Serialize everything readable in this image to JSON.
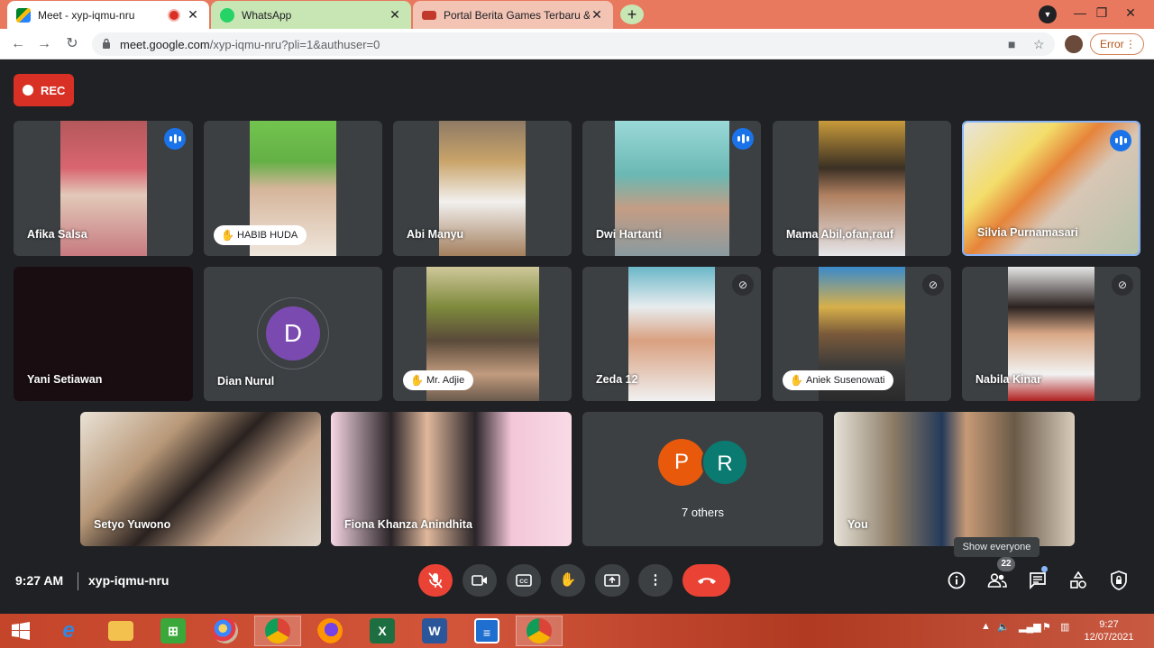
{
  "browser": {
    "tabs": [
      {
        "title": "Meet - xyp-iqmu-nru",
        "close": "✕"
      },
      {
        "title": "WhatsApp",
        "close": "✕"
      },
      {
        "title": "Portal Berita Games Terbaru & Te",
        "close": "✕"
      }
    ],
    "new_tab": "+",
    "url_host": "meet.google.com",
    "url_rest": "/xyp-iqmu-nru?pli=1&authuser=0",
    "error_label": "Error",
    "window_controls": {
      "minimize": "—",
      "restore": "❐",
      "close": "✕"
    }
  },
  "meet": {
    "rec_label": "REC",
    "tiles": [
      {
        "name": "Afika Salsa",
        "state": "speaking"
      },
      {
        "name": "HABIB HUDA",
        "state": "hand"
      },
      {
        "name": "Abi Manyu",
        "state": "none"
      },
      {
        "name": "Dwi Hartanti",
        "state": "speaking"
      },
      {
        "name": "Mama Abil,ofan,rauf",
        "state": "none"
      },
      {
        "name": "Silvia Purnamasari",
        "state": "speaking"
      },
      {
        "name": "Yani Setiawan",
        "state": "none"
      },
      {
        "name": "Dian Nurul",
        "state": "avatar",
        "initial": "D"
      },
      {
        "name": "Mr. Adjie",
        "state": "hand"
      },
      {
        "name": "Zeda 12",
        "state": "muted"
      },
      {
        "name": "Aniek Susenowati",
        "state": "hand-muted"
      },
      {
        "name": "Nabila Kinar",
        "state": "muted"
      },
      {
        "name": "Setyo Yuwono",
        "state": "none"
      },
      {
        "name": "Fiona Khanza Anindhita",
        "state": "none"
      },
      {
        "name": "7 others",
        "state": "others",
        "initials": [
          "P",
          "R"
        ]
      },
      {
        "name": "You",
        "state": "none"
      }
    ],
    "clock": "9:27 AM",
    "meeting_code": "xyp-iqmu-nru",
    "people_count": "22",
    "tooltip": "Show everyone"
  },
  "taskbar": {
    "time": "9:27",
    "date": "12/07/2021"
  },
  "colors": {
    "meet_bg": "#202124",
    "tile_bg": "#3c4043",
    "rec_red": "#d93025",
    "speaking_blue": "#1a73e8",
    "avatar_purple": "#7b4ab0",
    "avatar_orange": "#e8590c",
    "avatar_teal": "#0b7a70"
  }
}
